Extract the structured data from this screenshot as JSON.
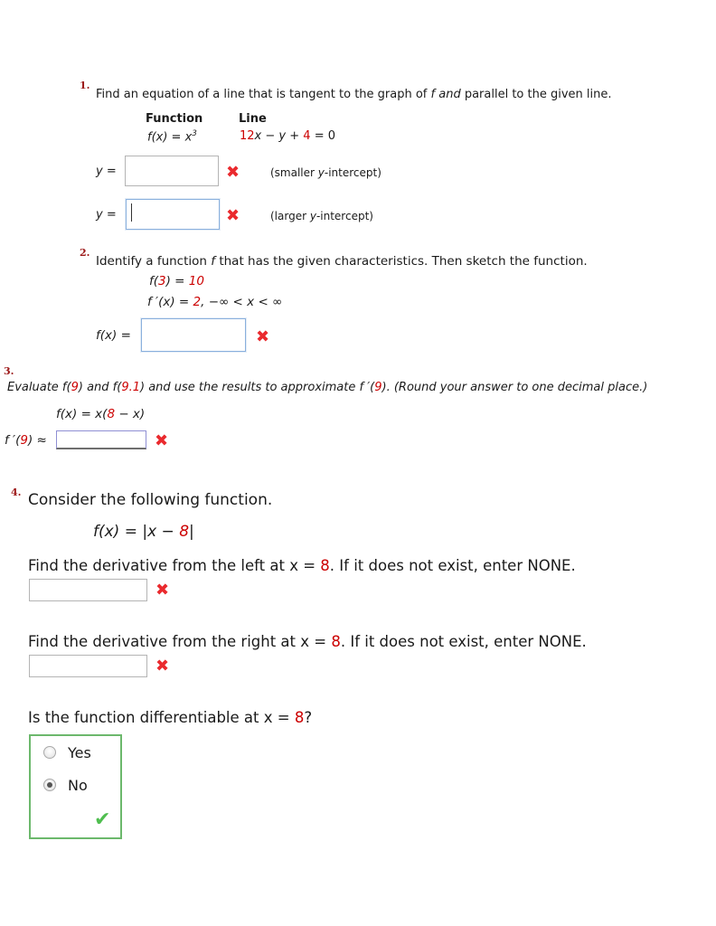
{
  "document": {
    "type": "online-math-homework-worksheet",
    "accent_red": "#cc0000",
    "mark_wrong_color": "#ea2a2e",
    "mark_correct_color": "#4fbe4f"
  },
  "problems": [
    {
      "number": "1.",
      "prompt_parts": {
        "a": "Find an equation of a line that is tangent to the graph of ",
        "f": "f",
        "b": " and",
        "c": " parallel to the given line."
      },
      "table": {
        "header_function": "Function",
        "header_line": "Line",
        "function_lhs": "f(x) = x",
        "function_exp": "3",
        "line_coef": "12",
        "line_x": "x",
        "line_minus": " − ",
        "line_y": "y",
        "line_plus": " + ",
        "line_const": "4",
        "line_tail": " = 0"
      },
      "answers": [
        {
          "label": "y  =",
          "value": "",
          "note": "(smaller y-intercept)",
          "note_pre": "(smaller ",
          "note_var": "y",
          "note_post": "-intercept)",
          "status": "incorrect",
          "status_glyph": "✖",
          "focused": false
        },
        {
          "label": "y  =",
          "value": "",
          "note_pre": "(larger ",
          "note_var": "y",
          "note_post": "-intercept)",
          "status": "incorrect",
          "status_glyph": "✖",
          "focused": true
        }
      ]
    },
    {
      "number": "2.",
      "prompt_pre": "Identify a function ",
      "prompt_f": "f",
      "prompt_post": " that has the given characteristics. Then sketch the function.",
      "given": [
        {
          "lhs": "f(",
          "arg": "3",
          "mid": ") = ",
          "rhs": "10"
        },
        {
          "lhs": "f ′(x) = ",
          "rhs": "2",
          "tail": ",  −∞ < x < ∞"
        }
      ],
      "answer": {
        "label": "f(x) =",
        "value": "",
        "status": "incorrect",
        "status_glyph": "✖",
        "focused": true
      }
    },
    {
      "number": "3.",
      "prompt_p1": "Evaluate f(",
      "prompt_v1": "9",
      "prompt_p2": ") and f(",
      "prompt_v2": "9.1",
      "prompt_p3": ") and use the results to approximate f ′(",
      "prompt_v3": "9",
      "prompt_p4": "). (Round your answer to one decimal place.)",
      "given_lhs": "f(x) = x(",
      "given_val": "8",
      "given_rhs": " − x)",
      "answer": {
        "label_pre": "f ′(",
        "label_val": "9",
        "label_post": ") ≈",
        "value": "",
        "status": "incorrect",
        "status_glyph": "✖"
      }
    },
    {
      "number": "4.",
      "heading": "Consider the following function.",
      "function_pre": "f(x)  =  |x − ",
      "function_val": "8",
      "function_post": "|",
      "questions": [
        {
          "text_pre": "Find the derivative from the left at x = ",
          "text_val": "8",
          "text_post": ". If it does not exist, enter NONE.",
          "value": "",
          "status": "incorrect",
          "status_glyph": "✖"
        },
        {
          "text_pre": "Find the derivative from the right at x = ",
          "text_val": "8",
          "text_post": ". If it does not exist, enter NONE.",
          "value": "",
          "status": "incorrect",
          "status_glyph": "✖"
        }
      ],
      "differentiable": {
        "text_pre": "Is the function differentiable at x = ",
        "text_val": "8",
        "text_post": "?",
        "options": [
          {
            "label": "Yes",
            "selected": false
          },
          {
            "label": "No",
            "selected": true
          }
        ],
        "status": "correct",
        "status_glyph": "✔"
      }
    }
  ]
}
